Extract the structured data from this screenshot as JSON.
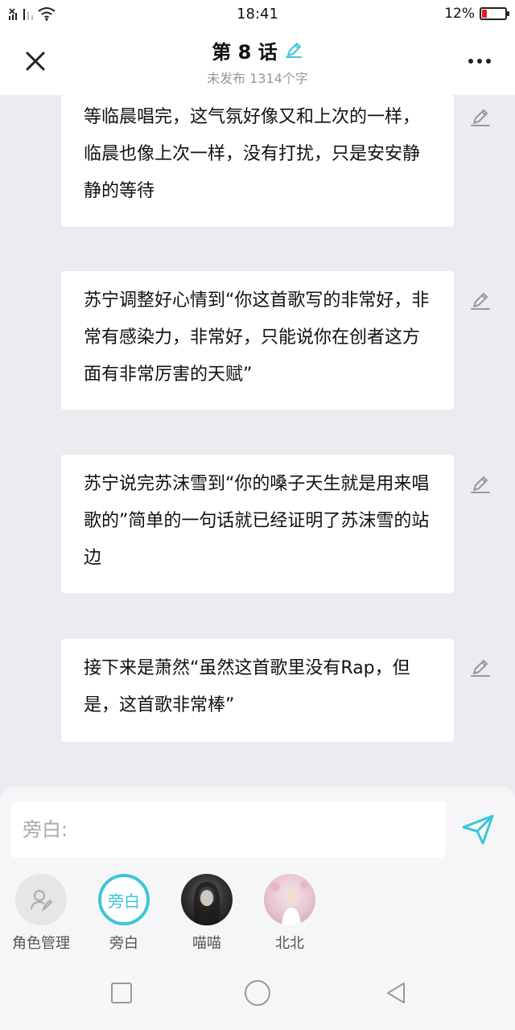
{
  "status_bar": {
    "time": "18:41",
    "battery": "12%",
    "battery_level": 0.12,
    "icons": [
      "sim-icon",
      "signal-icon",
      "wifi-icon",
      "battery-icon"
    ]
  },
  "header": {
    "title": "第 8 话",
    "subtitle": "未发布 1314个字",
    "accent_color": "#3cc6d8"
  },
  "cards": [
    {
      "text": "等临晨唱完，这气氛好像又和上次的一样，临晨也像上次一样，没有打扰，只是安安静静的等待"
    },
    {
      "text": "苏宁调整好心情到“你这首歌写的非常好，非常有感染力，非常好，只能说你在创者这方面有非常厉害的天赋”"
    },
    {
      "text": "苏宁说完苏沫雪到“你的嗓子天生就是用来唱歌的”简单的一句话就已经证明了苏沫雪的站边"
    },
    {
      "text": "接下来是萧然“虽然这首歌里没有Rap，但是，这首歌非常棒”"
    }
  ],
  "composer": {
    "placeholder": "旁白:",
    "roles": [
      {
        "label": "角色管理",
        "icon": "role-manage-icon"
      },
      {
        "label": "旁白",
        "avatar_text": "旁白",
        "selected": true
      },
      {
        "label": "喵喵",
        "avatar": "photo"
      },
      {
        "label": "北北",
        "avatar": "photo"
      }
    ]
  },
  "navbar": {
    "icons": [
      "recent-apps-icon",
      "home-icon",
      "back-icon"
    ]
  }
}
